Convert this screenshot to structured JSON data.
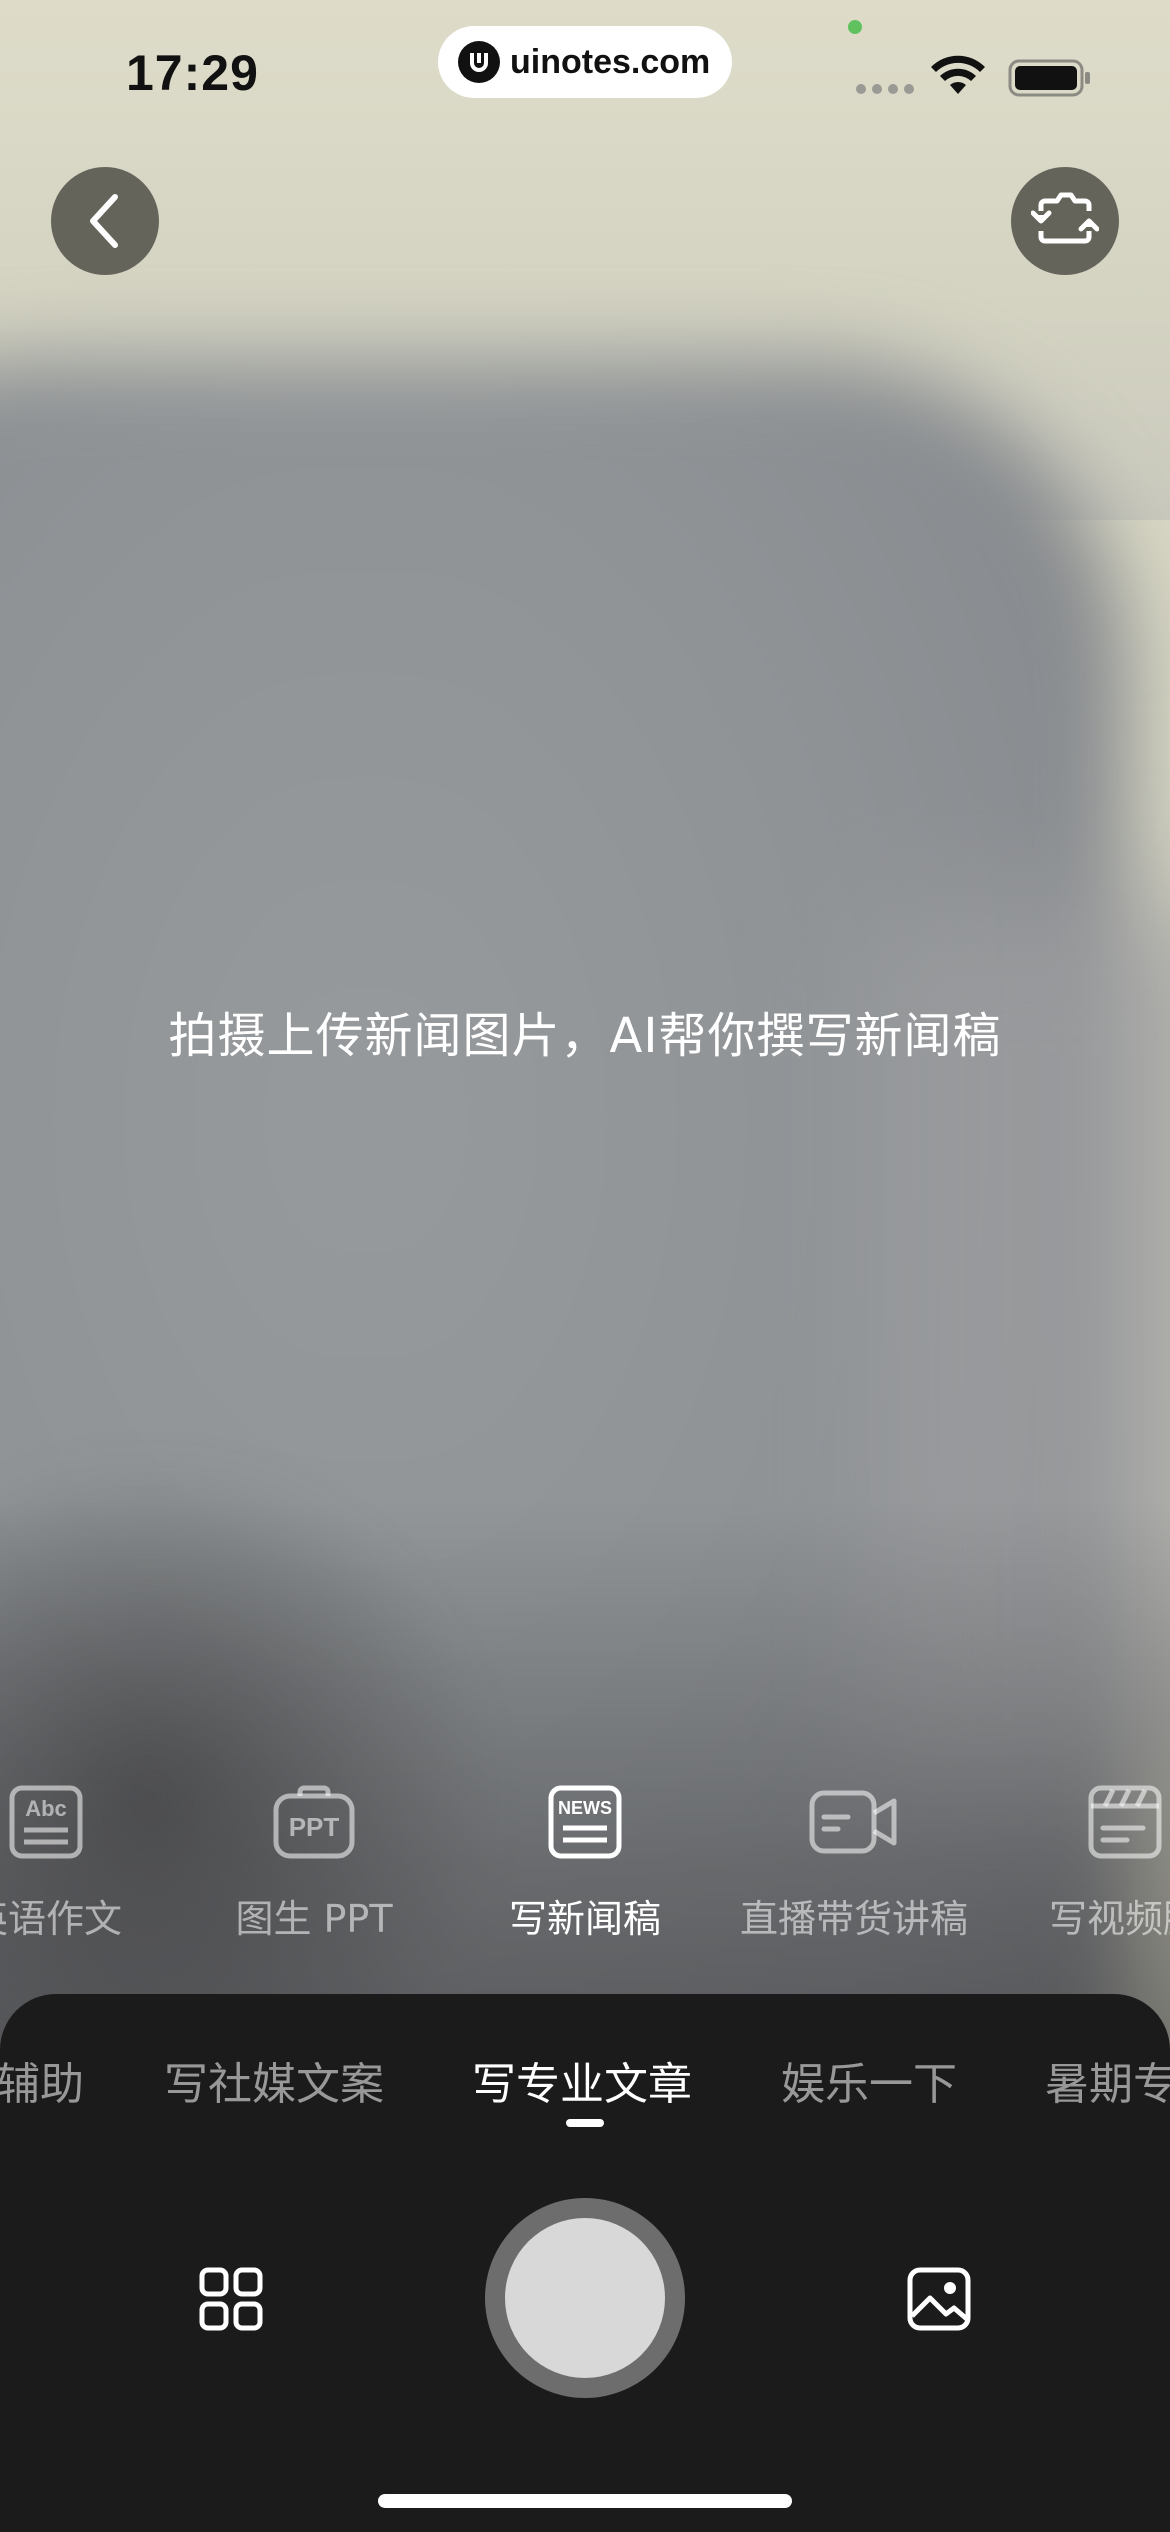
{
  "status_bar": {
    "time": "17:29",
    "url": "uinotes.com"
  },
  "icons": {
    "back": "chevron-left-icon",
    "flip": "camera-flip-icon",
    "grid": "grid-icon",
    "gallery": "image-icon"
  },
  "hint": "拍摄上传新闻图片，AI帮你撰写新闻稿",
  "modes": [
    {
      "label": "英语作文",
      "icon": "abc-doc-icon"
    },
    {
      "label": "图生 PPT",
      "icon": "ppt-icon"
    },
    {
      "label": "写新闻稿",
      "icon": "news-icon",
      "active": true
    },
    {
      "label": "直播带货讲稿",
      "icon": "video-camera-icon"
    },
    {
      "label": "写视频脚",
      "icon": "clapperboard-icon"
    }
  ],
  "categories": [
    {
      "label": "辅助"
    },
    {
      "label": "写社媒文案"
    },
    {
      "label": "写专业文章",
      "active": true
    },
    {
      "label": "娱乐一下"
    },
    {
      "label": "暑期专"
    }
  ],
  "colors": {
    "panel": "#1b1b1b",
    "url_pill": "#ffffff",
    "mic_dot": "#5fc25f"
  }
}
